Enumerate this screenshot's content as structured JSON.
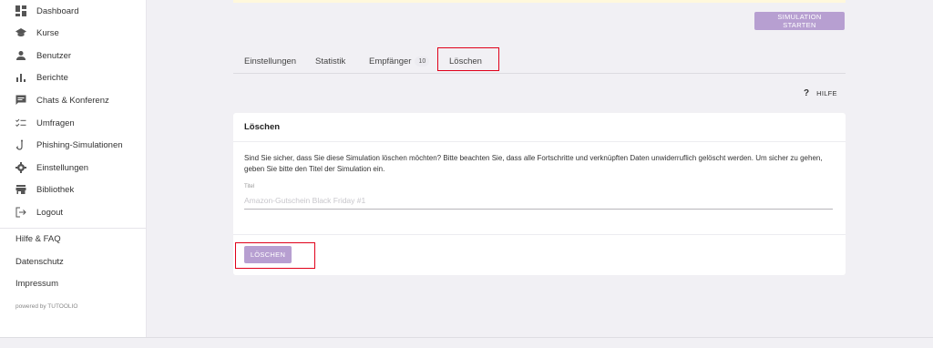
{
  "sidebar": {
    "items": [
      {
        "label": "Dashboard",
        "icon": "dashboard-icon"
      },
      {
        "label": "Kurse",
        "icon": "graduation-cap-icon"
      },
      {
        "label": "Benutzer",
        "icon": "user-icon"
      },
      {
        "label": "Berichte",
        "icon": "bar-chart-icon"
      },
      {
        "label": "Chats & Konferenz",
        "icon": "chat-icon"
      },
      {
        "label": "Umfragen",
        "icon": "checklist-icon"
      },
      {
        "label": "Phishing-Simulationen",
        "icon": "fishhook-icon"
      },
      {
        "label": "Einstellungen",
        "icon": "gear-icon"
      },
      {
        "label": "Bibliothek",
        "icon": "store-icon"
      },
      {
        "label": "Logout",
        "icon": "logout-icon"
      }
    ],
    "links": [
      "Hilfe & FAQ",
      "Datenschutz",
      "Impressum"
    ],
    "powered_by": "powered by TUTOOLIO"
  },
  "header": {
    "simulation_button": "SIMULATION STARTEN"
  },
  "tabs": [
    {
      "label": "Einstellungen"
    },
    {
      "label": "Statistik"
    },
    {
      "label": "Empfänger",
      "badge": "10"
    },
    {
      "label": "Löschen",
      "active": true
    }
  ],
  "help": {
    "icon_glyph": "?",
    "label": "HILFE"
  },
  "card": {
    "title": "Löschen",
    "description": "Sind Sie sicher, dass Sie diese Simulation löschen möchten? Bitte beachten Sie, dass alle Fortschritte und verknüpften Daten unwiderruflich gelöscht werden. Um sicher zu gehen, geben Sie bitte den Titel der Simulation ein.",
    "field_label": "Titel",
    "field_placeholder": "Amazon-Gutschein Black Friday #1",
    "field_value": "",
    "delete_button": "LÖSCHEN"
  },
  "colors": {
    "accent": "#b79fd1",
    "highlight": "#e0001a",
    "background": "#f1f0f4"
  }
}
